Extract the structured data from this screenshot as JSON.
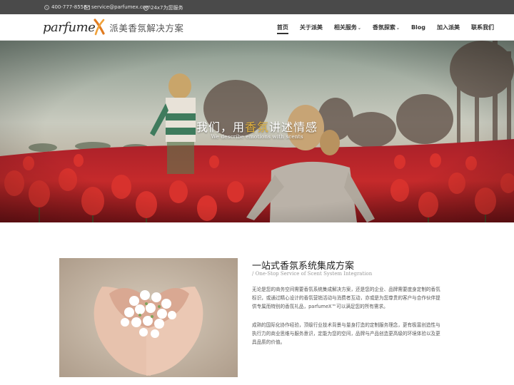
{
  "topbar": {
    "phone": "400-777-8558",
    "email": "service@parfumex.com",
    "service": "24x7为您服务",
    "icons": [
      "phone-icon",
      "mail-icon",
      "clock-icon"
    ]
  },
  "brand": {
    "logo_text": "parfume",
    "logo_tagline": "派美香氛解决方案",
    "accent_color": "#e07b20"
  },
  "nav": {
    "items": [
      {
        "label": "首页",
        "active": true
      },
      {
        "label": "关于派美"
      },
      {
        "label": "相关服务",
        "caret": "⌄"
      },
      {
        "label": "香氛探索",
        "caret": "⌄"
      },
      {
        "label": "Blog"
      },
      {
        "label": "加入派美"
      },
      {
        "label": "联系我们"
      }
    ]
  },
  "hero": {
    "title_pre": "我们，用",
    "title_highlight": "香氛",
    "title_post": "讲述情感",
    "subtitle": "We describe emotions with scents",
    "highlight_color": "#e3b23c"
  },
  "section": {
    "title": "一站式香氛系统集成方案",
    "subtitle": "/ One-Stop Service of Scent System Integration",
    "para1": [
      "无论是您的商务空间需要香氛系统集成解决方案，还是您的企业、品牌需要度身定制的香氛",
      "标识，或通过精心设计的香氛营销活动与消费者互动，亦或是为您尊贵的客户与合作伙伴提",
      "供专属而特别的香氛礼品，parfumeX™可以满足您的所有需求。"
    ],
    "para2": [
      "成熟的国际化协作经验，顶级行业技术背景与量身打造的定制服务理念，更有极富创造性与",
      "执行力的商业思维与服务意识，定能为您的空间，品牌与产品创造更高级的环境体验以及更",
      "具品质的价值。"
    ]
  }
}
